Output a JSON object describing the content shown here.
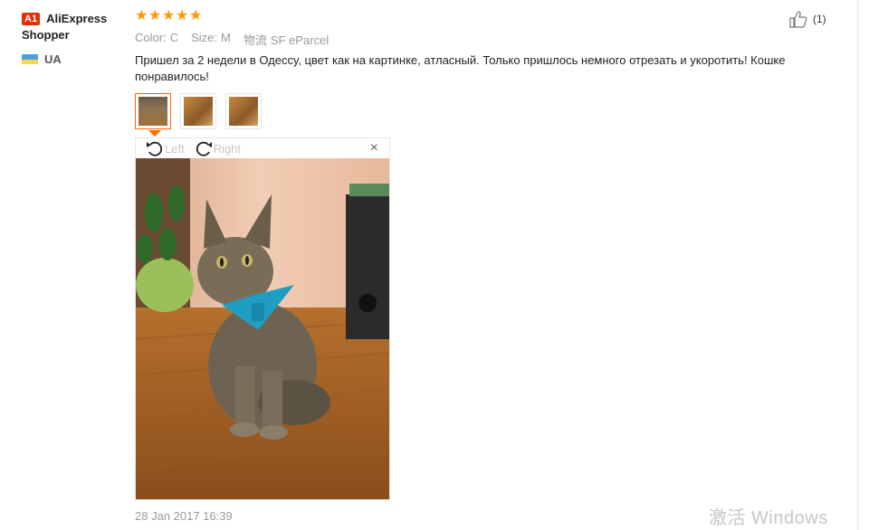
{
  "user": {
    "badge": "A1",
    "name": "AliExpress Shopper",
    "country": "UA"
  },
  "rating": {
    "stars": 5,
    "max": 5
  },
  "likes": {
    "count_label": "(1)"
  },
  "meta": {
    "color_key": "Color:",
    "color_value": "C",
    "size_key": "Size:",
    "size_value": "M",
    "shipping_key": "物流",
    "shipping_value": "SF eParcel"
  },
  "review_text": "Пришел за 2 недели в Одессу, цвет как на картинке, атласный. Только пришлось немного отрезать и укоротить! Кошке понравилось!",
  "thumbnails": {
    "count": 3,
    "active_index": 0
  },
  "viewer": {
    "rotate_left_label": "Left",
    "rotate_right_label": "Right",
    "close_label": "×"
  },
  "date": "28 Jan 2017 16:39",
  "watermark": "激活 Windows",
  "colors": {
    "star": "#ff9a00",
    "active_border": "#ff6600",
    "badge": "#e62e04"
  }
}
